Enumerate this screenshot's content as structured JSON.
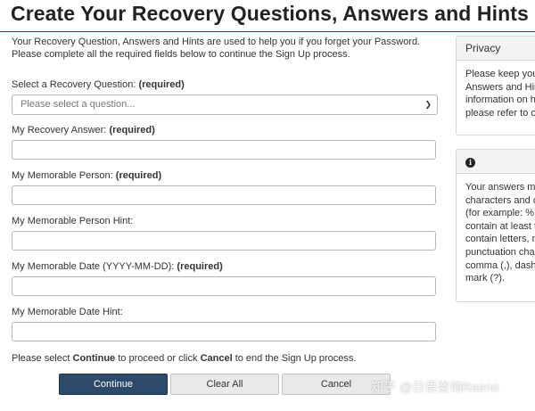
{
  "page": {
    "title": "Create Your Recovery Questions, Answers and Hints",
    "intro": "Your Recovery Question, Answers and Hints are used to help you if you forget your Password. Please complete all the required fields below to continue the Sign Up process."
  },
  "form": {
    "required_tag": "(required)",
    "question": {
      "label": "Select a Recovery Question:",
      "placeholder": "Please select a question..."
    },
    "answer": {
      "label": "My Recovery Answer:",
      "value": ""
    },
    "person": {
      "label": "My Memorable Person:",
      "value": ""
    },
    "person_hint": {
      "label": "My Memorable Person Hint:",
      "value": ""
    },
    "date": {
      "label": "My Memorable Date (YYYY-MM-DD):",
      "value": ""
    },
    "date_hint": {
      "label": "My Memorable Date Hint:",
      "value": ""
    }
  },
  "footer": {
    "prefix": "Please select",
    "continue_word": "Continue",
    "middle": "to proceed or click",
    "cancel_word": "Cancel",
    "suffix": "to end the Sign Up process."
  },
  "buttons": {
    "continue": "Continue",
    "clear_all": "Clear All",
    "cancel": "Cancel"
  },
  "side": {
    "privacy": {
      "title": "Privacy",
      "lines": [
        "Please keep your",
        "Answers and Hint",
        "information on ho",
        "please refer to ou"
      ]
    },
    "info": {
      "icon": "info-icon",
      "lines": [
        "Your answers mu",
        "characters and co",
        "(for example: %, #",
        "contain at least th",
        "contain letters, nu",
        "punctuation chara",
        "comma (,), dash (",
        "mark (?)."
      ]
    }
  },
  "watermark": "知乎 @日语咨询Raeno",
  "colors": {
    "primary_button": "#2e4a6b",
    "title_rule": "#7a1a3a"
  }
}
